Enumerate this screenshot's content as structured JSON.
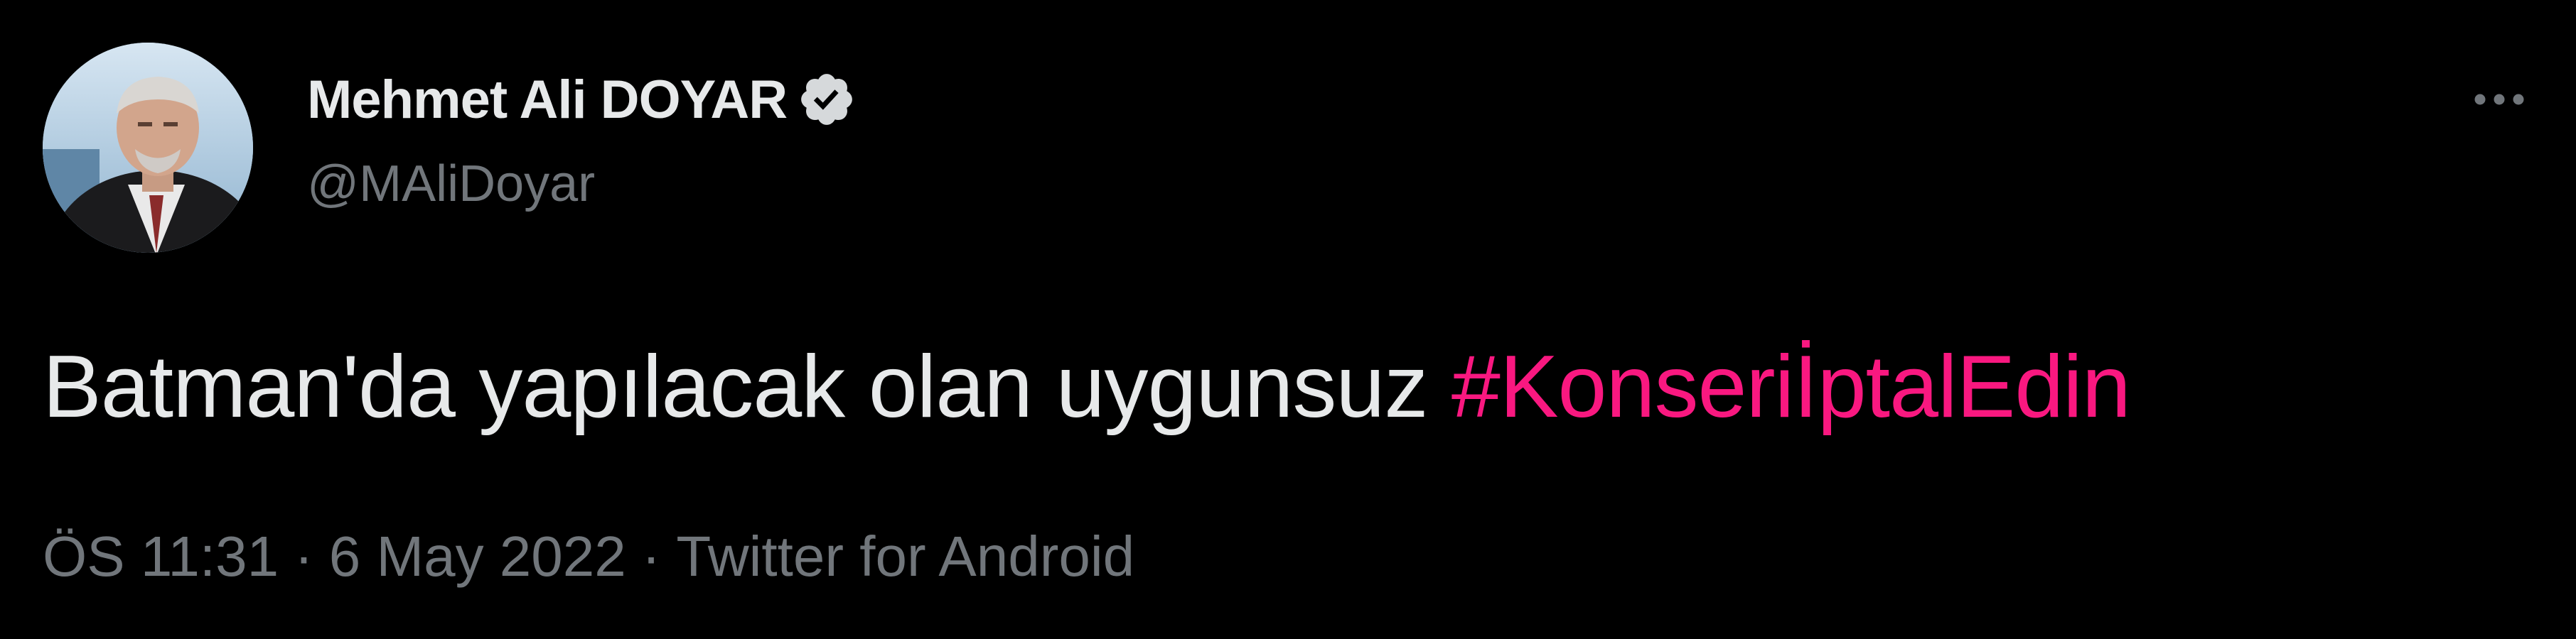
{
  "author": {
    "display_name": "Mehmet Ali DOYAR",
    "handle": "@MAliDoyar",
    "verified_icon": "verified-badge-icon",
    "avatar_icon": "profile-photo"
  },
  "tweet": {
    "text": "Batman'da yapılacak olan uygunsuz ",
    "hashtag": "#Konserİİptal Edin"
  },
  "meta": {
    "time": "ÖS 11:31",
    "separator": "·",
    "date": "6 May 2022",
    "source": "Twitter for Android"
  },
  "colors": {
    "background": "#000000",
    "primary_text": "#e7e9ea",
    "secondary_text": "#71767b",
    "hashtag": "#f91880"
  },
  "icons": {
    "more": "more-horizontal-icon"
  }
}
